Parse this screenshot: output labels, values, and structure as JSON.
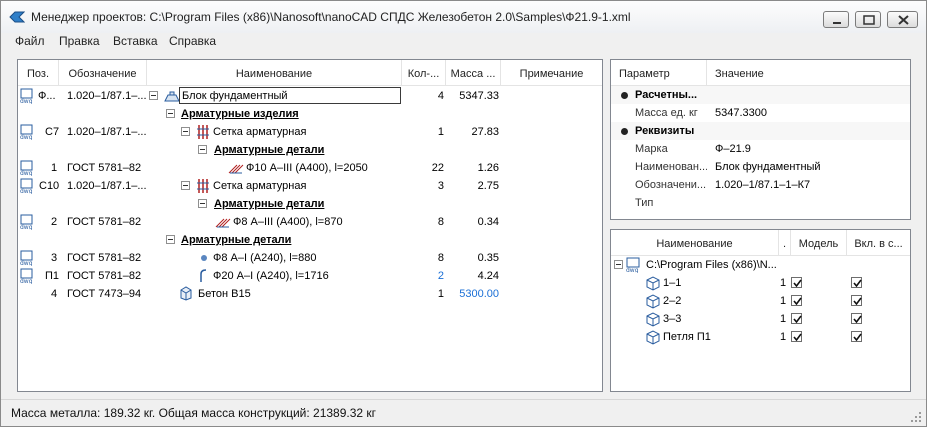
{
  "window": {
    "title": "Менеджер проектов: C:\\Program Files (x86)\\Nanosoft\\nanoCAD СПДС Железобетон 2.0\\Samples\\Ф21.9-1.xml"
  },
  "menu": [
    "Файл",
    "Правка",
    "Вставка",
    "Справка"
  ],
  "spec_table": {
    "headers": {
      "pos": "Поз.",
      "designation": "Обозначение",
      "name": "Наименование",
      "qty": "Кол-...",
      "mass": "Масса ...",
      "note": "Примечание"
    },
    "rows": [
      {
        "pos": "Ф...",
        "designation": "1.020–1/87.1–...",
        "name": "Блок фундаментный",
        "qty": "4",
        "mass": "5347.33"
      },
      {
        "name": "Арматурные изделия"
      },
      {
        "pos": "С7",
        "designation": "1.020–1/87.1–...",
        "name": "Сетка арматурная",
        "qty": "1",
        "mass": "27.83"
      },
      {
        "name": "Арматурные детали"
      },
      {
        "pos": "1",
        "designation": "ГОСТ 5781–82",
        "name": "Ф10 А–III (А400), l=2050",
        "qty": "22",
        "mass": "1.26"
      },
      {
        "pos": "С10",
        "designation": "1.020–1/87.1–...",
        "name": "Сетка арматурная",
        "qty": "3",
        "mass": "2.75"
      },
      {
        "name": "Арматурные детали"
      },
      {
        "pos": "2",
        "designation": "ГОСТ 5781–82",
        "name": "Ф8 А–III (А400), l=870",
        "qty": "8",
        "mass": "0.34"
      },
      {
        "name": "Арматурные детали"
      },
      {
        "pos": "3",
        "designation": "ГОСТ 5781–82",
        "name": "Ф8 А–I (А240), l=880",
        "qty": "8",
        "mass": "0.35"
      },
      {
        "pos": "П1",
        "designation": "ГОСТ 5781–82",
        "name": "Ф20 А–I (А240), l=1716",
        "qty": "2",
        "mass": "4.24"
      },
      {
        "pos": "4",
        "designation": "ГОСТ 7473–94",
        "name": "Бетон В15",
        "qty": "1",
        "mass": "5300.00"
      }
    ]
  },
  "properties": {
    "headers": {
      "param": "Параметр",
      "value": "Значение"
    },
    "groups": [
      {
        "label": "Расчетны...",
        "items": [
          {
            "param": "Масса ед. кг",
            "value": "5347.3300"
          }
        ]
      },
      {
        "label": "Реквизиты",
        "items": [
          {
            "param": "Марка",
            "value": "Ф–21.9"
          },
          {
            "param": "Наименован...",
            "value": "Блок фундаментный"
          },
          {
            "param": "Обозначени...",
            "value": "1.020–1/87.1–1–К7"
          },
          {
            "param": "Тип",
            "value": ""
          }
        ]
      }
    ]
  },
  "layers": {
    "headers": {
      "name": "Наименование",
      "dot": ".",
      "model": "Модель",
      "include": "Вкл. в с..."
    },
    "root": "C:\\Program Files (x86)\\N...",
    "items": [
      {
        "name": "1–1",
        "num": "1"
      },
      {
        "name": "2–2",
        "num": "1"
      },
      {
        "name": "3–3",
        "num": "1"
      },
      {
        "name": "Петля П1",
        "num": "1"
      }
    ]
  },
  "status": {
    "text": "Масса металла: 189.32 кг. Общая масса конструкций: 21389.32 кг"
  },
  "colors": {
    "accent_blue": "#1a6fd6",
    "selection_border": "#3a3a3a"
  }
}
